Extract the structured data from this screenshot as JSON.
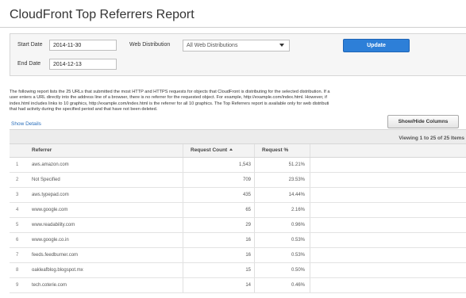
{
  "page": {
    "title": "CloudFront Top Referrers Report"
  },
  "filters": {
    "start_date_label": "Start Date",
    "start_date_value": "2014-11-30",
    "end_date_label": "End Date",
    "end_date_value": "2014-12-13",
    "web_distribution_label": "Web Distribution",
    "web_distribution_value": "All Web Distributions",
    "update_label": "Update"
  },
  "description": {
    "line1": "The following report lists the 25 URLs that submitted the most HTTP and HTTPS requests for objects that CloudFront is distributing for the selected distribution. If a",
    "line2": "user enters a URL directly into the address line of a browser, there is no referrer for the requested object. For example, http://example.com/index.html. However, if",
    "line3": "index.html includes links to 10 graphics, http://example.com/index.html is the referrer for all 10 graphics. The Top Referrers report is available only for web distributi",
    "line4": "that had activity during the specified period and that have not been deleted."
  },
  "controls": {
    "show_details_label": "Show Details",
    "show_hide_columns_label": "Show/Hide Columns",
    "viewing_label": "Viewing 1 to 25 of 25 Items"
  },
  "table": {
    "columns": {
      "referrer": "Referrer",
      "request_count": "Request Count",
      "request_pct": "Request %"
    },
    "rows": [
      {
        "num": "1",
        "referrer": "aws.amazon.com",
        "count": "1,543",
        "pct": "51.21%"
      },
      {
        "num": "2",
        "referrer": "Not Specified",
        "count": "709",
        "pct": "23.53%"
      },
      {
        "num": "3",
        "referrer": "aws.typepad.com",
        "count": "435",
        "pct": "14.44%"
      },
      {
        "num": "4",
        "referrer": "www.google.com",
        "count": "65",
        "pct": "2.16%"
      },
      {
        "num": "5",
        "referrer": "www.readability.com",
        "count": "29",
        "pct": "0.96%"
      },
      {
        "num": "6",
        "referrer": "www.google.co.in",
        "count": "16",
        "pct": "0.53%"
      },
      {
        "num": "7",
        "referrer": "feeds.feedburner.com",
        "count": "16",
        "pct": "0.53%"
      },
      {
        "num": "8",
        "referrer": "oakleafblog.blogspot.mx",
        "count": "15",
        "pct": "0.50%"
      },
      {
        "num": "9",
        "referrer": "tech.coterie.com",
        "count": "14",
        "pct": "0.46%"
      }
    ]
  },
  "colors": {
    "accent": "#2d7fd8",
    "link": "#2a6ebb"
  }
}
